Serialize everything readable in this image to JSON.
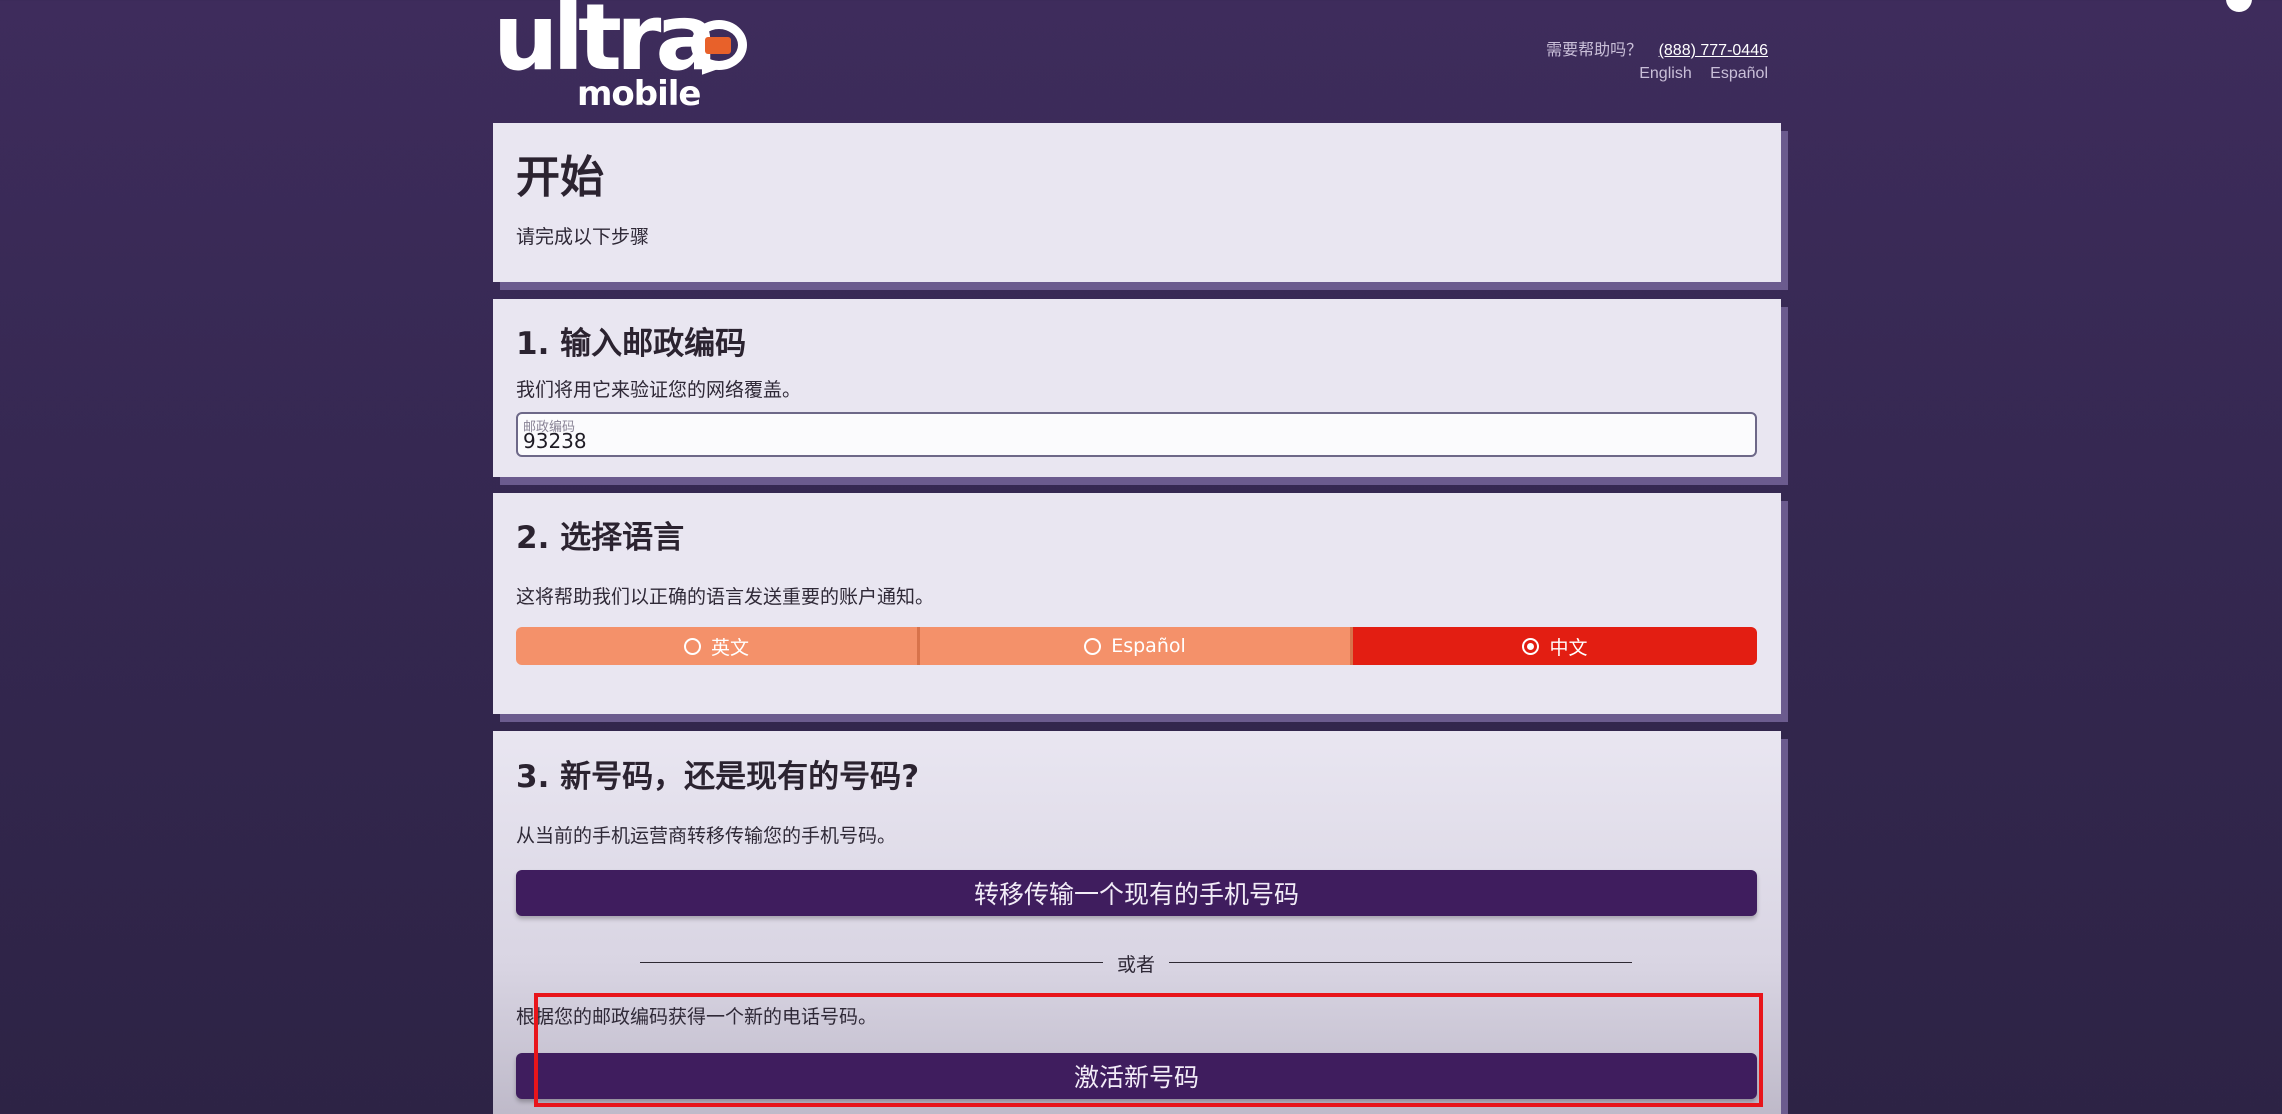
{
  "header": {
    "logo_text": "ultra",
    "logo_subtext": "mobile",
    "help_prompt": "需要帮助吗？",
    "phone": "(888) 777-0446",
    "languages": [
      "English",
      "Español"
    ]
  },
  "intro": {
    "title": "开始",
    "subtitle": "请完成以下步骤"
  },
  "step1": {
    "title": "1. 输入邮政编码",
    "description": "我们将用它来验证您的网络覆盖。",
    "zip_label": "邮政编码",
    "zip_value": "93238"
  },
  "step2": {
    "title": "2. 选择语言",
    "description": "这将帮助我们以正确的语言发送重要的账户通知。",
    "options": [
      {
        "label": "英文",
        "selected": false
      },
      {
        "label": "Español",
        "selected": false
      },
      {
        "label": "中文",
        "selected": true
      }
    ]
  },
  "step3": {
    "title": "3. 新号码，还是现有的号码?",
    "transfer_description": "从当前的手机运营商转移传输您的手机号码。",
    "transfer_button": "转移传输一个现有的手机号码",
    "or_text": "或者",
    "new_description": "根据您的邮政编码获得一个新的电话号码。",
    "activate_button": "激活新号码"
  },
  "colors": {
    "background": "#3a2a57",
    "card": "#e9e6f1",
    "button": "#3f1d5e",
    "option_inactive": "#f4916a",
    "option_active": "#e31e12",
    "highlight": "#e8151b"
  }
}
